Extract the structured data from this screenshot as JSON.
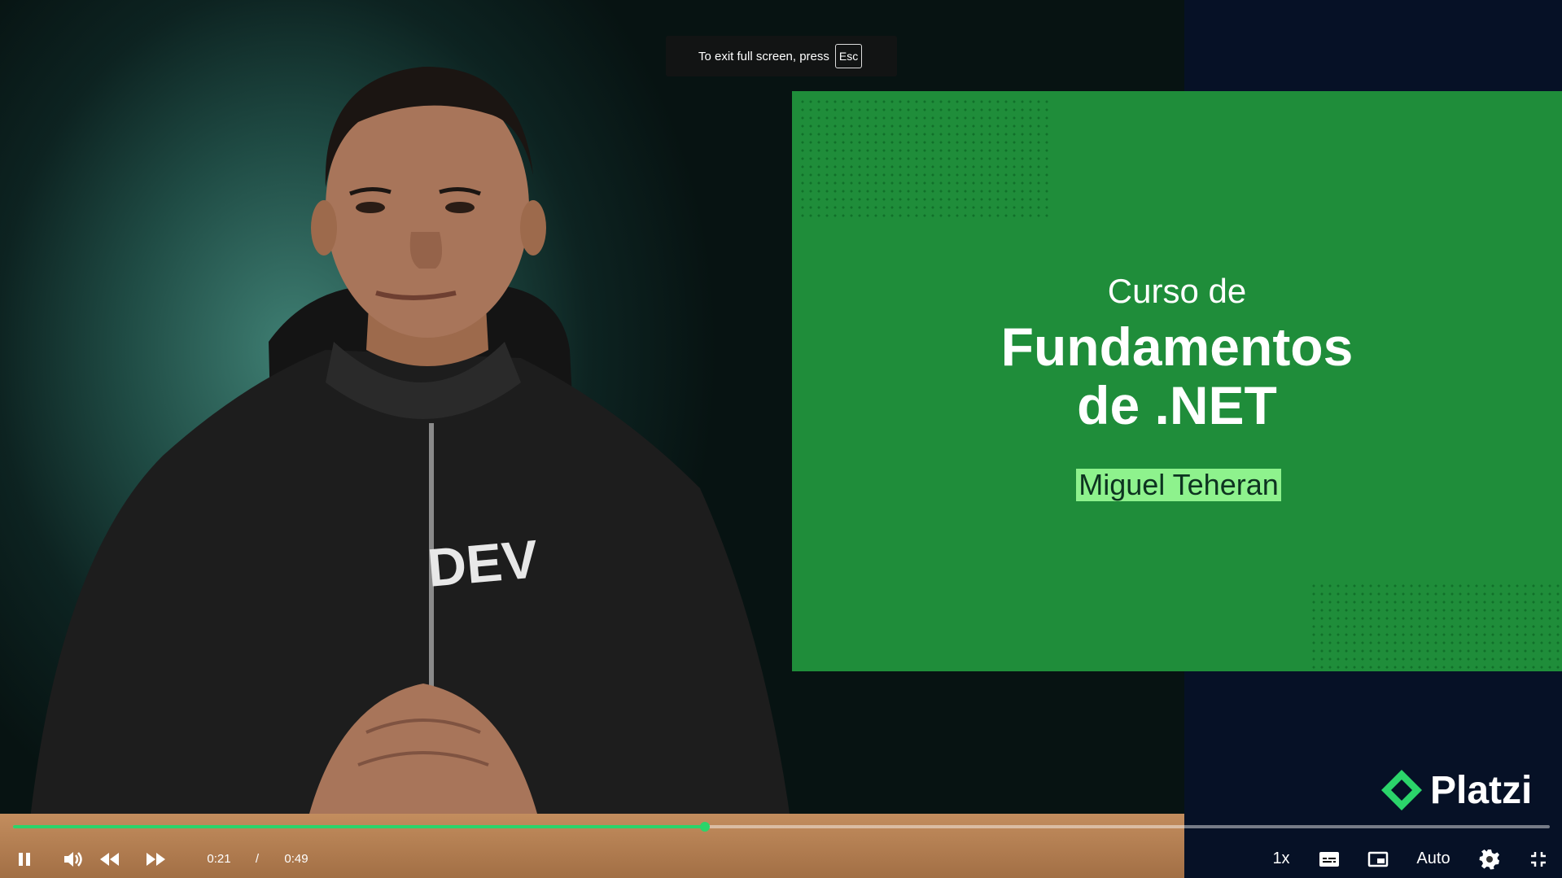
{
  "notice": {
    "text": "To exit full screen, press",
    "key": "Esc"
  },
  "slide": {
    "subtitle": "Curso de",
    "title_line1": "Fundamentos",
    "title_line2": "de .NET",
    "author": "Miguel Teheran"
  },
  "brand": {
    "logo_text": "Platzi",
    "color": "#2bd46a"
  },
  "shirt_text": "DEV",
  "player": {
    "current_time": "0:21",
    "separator": "/",
    "duration": "0:49",
    "progress_fraction": 0.45,
    "speed": "1x",
    "quality": "Auto"
  },
  "icons": {
    "play_pause": "pause-icon",
    "volume": "volume-icon",
    "rewind": "rewind-icon",
    "forward": "fast-forward-icon",
    "captions": "captions-icon",
    "pip": "picture-in-picture-icon",
    "settings": "gear-icon",
    "exit_fullscreen": "exit-fullscreen-icon"
  },
  "colors": {
    "slide_green": "#1f8d3a",
    "author_highlight": "#8ef28d",
    "progress": "#2bd46a"
  }
}
